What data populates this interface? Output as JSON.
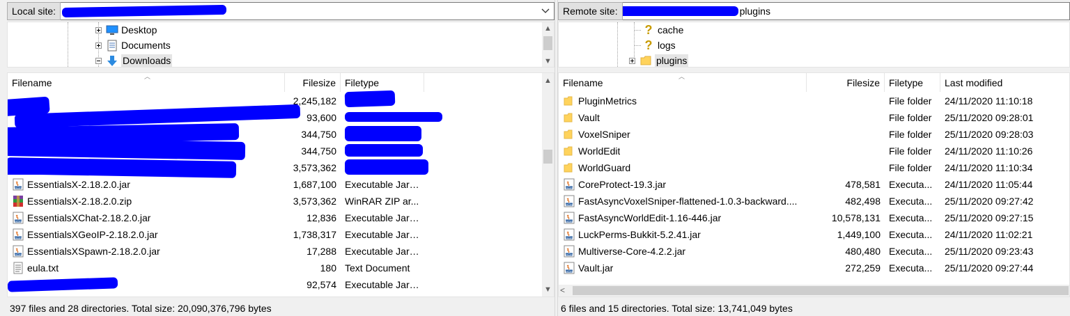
{
  "colors": {
    "redaction": "#0000ff",
    "folder": "#ffd35c",
    "selection": "#e5e5e5"
  },
  "local": {
    "site_label": "Local site:",
    "site_path": "",
    "tree": [
      {
        "label": "Desktop",
        "icon": "desktop-icon",
        "expander": "plus"
      },
      {
        "label": "Documents",
        "icon": "documents-icon",
        "expander": "plus"
      },
      {
        "label": "Downloads",
        "icon": "downloads-icon",
        "expander": "minus",
        "selected": true
      }
    ],
    "columns": [
      "Filename",
      "Filesize",
      "Filetype"
    ],
    "files": [
      {
        "name": "",
        "size": "2,245,182",
        "type": "",
        "icon": "redacted"
      },
      {
        "name": "",
        "size": "93,600",
        "type": "",
        "icon": "redacted"
      },
      {
        "name": "",
        "size": "344,750",
        "type": "",
        "icon": "redacted"
      },
      {
        "name": "",
        "size": "344,750",
        "type": "",
        "icon": "redacted"
      },
      {
        "name": "",
        "size": "3,573,362",
        "type": "",
        "icon": "redacted"
      },
      {
        "name": "EssentialsX-2.18.2.0.jar",
        "size": "1,687,100",
        "type": "Executable Jar ...",
        "icon": "jar-icon"
      },
      {
        "name": "EssentialsX-2.18.2.0.zip",
        "size": "3,573,362",
        "type": "WinRAR ZIP ar...",
        "icon": "winrar-icon"
      },
      {
        "name": "EssentialsXChat-2.18.2.0.jar",
        "size": "12,836",
        "type": "Executable Jar ...",
        "icon": "jar-icon"
      },
      {
        "name": "EssentialsXGeoIP-2.18.2.0.jar",
        "size": "1,738,317",
        "type": "Executable Jar ...",
        "icon": "jar-icon"
      },
      {
        "name": "EssentialsXSpawn-2.18.2.0.jar",
        "size": "17,288",
        "type": "Executable Jar ...",
        "icon": "jar-icon"
      },
      {
        "name": "eula.txt",
        "size": "180",
        "type": "Text Document",
        "icon": "text-file-icon"
      },
      {
        "name": "",
        "size": "92,574",
        "type": "Executable Jar ...",
        "icon": "redacted"
      }
    ],
    "status": "397 files and 28 directories. Total size: 20,090,376,796 bytes"
  },
  "remote": {
    "site_label": "Remote site:",
    "site_path": "plugins",
    "tree": [
      {
        "label": "cache",
        "icon": "question-icon"
      },
      {
        "label": "logs",
        "icon": "question-icon"
      },
      {
        "label": "plugins",
        "icon": "folder-icon",
        "expander": "plus",
        "selected": true
      }
    ],
    "columns": [
      "Filename",
      "Filesize",
      "Filetype",
      "Last modified"
    ],
    "files": [
      {
        "name": "PluginMetrics",
        "size": "",
        "type": "File folder",
        "modified": "24/11/2020 11:10:18",
        "icon": "folder-icon"
      },
      {
        "name": "Vault",
        "size": "",
        "type": "File folder",
        "modified": "25/11/2020 09:28:01",
        "icon": "folder-icon"
      },
      {
        "name": "VoxelSniper",
        "size": "",
        "type": "File folder",
        "modified": "25/11/2020 09:28:03",
        "icon": "folder-icon"
      },
      {
        "name": "WorldEdit",
        "size": "",
        "type": "File folder",
        "modified": "24/11/2020 11:10:26",
        "icon": "folder-icon"
      },
      {
        "name": "WorldGuard",
        "size": "",
        "type": "File folder",
        "modified": "24/11/2020 11:10:34",
        "icon": "folder-icon"
      },
      {
        "name": "CoreProtect-19.3.jar",
        "size": "478,581",
        "type": "Executa...",
        "modified": "24/11/2020 11:05:44",
        "icon": "jar-icon"
      },
      {
        "name": "FastAsyncVoxelSniper-flattened-1.0.3-backward....",
        "size": "482,498",
        "type": "Executa...",
        "modified": "25/11/2020 09:27:42",
        "icon": "jar-icon"
      },
      {
        "name": "FastAsyncWorldEdit-1.16-446.jar",
        "size": "10,578,131",
        "type": "Executa...",
        "modified": "25/11/2020 09:27:15",
        "icon": "jar-icon"
      },
      {
        "name": "LuckPerms-Bukkit-5.2.41.jar",
        "size": "1,449,100",
        "type": "Executa...",
        "modified": "24/11/2020 11:02:21",
        "icon": "jar-icon"
      },
      {
        "name": "Multiverse-Core-4.2.2.jar",
        "size": "480,480",
        "type": "Executa...",
        "modified": "25/11/2020 09:23:43",
        "icon": "jar-icon"
      },
      {
        "name": "Vault.jar",
        "size": "272,259",
        "type": "Executa...",
        "modified": "25/11/2020 09:27:44",
        "icon": "jar-icon"
      }
    ],
    "status": "6 files and 15 directories. Total size: 13,741,049 bytes"
  }
}
